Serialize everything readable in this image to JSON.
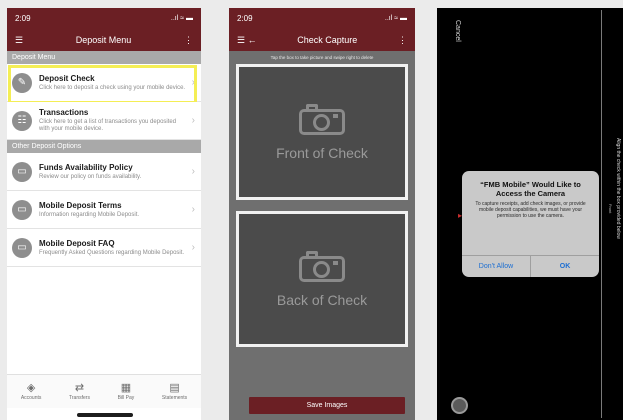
{
  "screen1": {
    "status": {
      "time": "2:09",
      "signal": "..ıl ≈ ▬"
    },
    "nav": {
      "title": "Deposit Menu"
    },
    "section1": "Deposit Menu",
    "items1": [
      {
        "title": "Deposit Check",
        "desc": "Click here to deposit a check using your mobile device."
      },
      {
        "title": "Transactions",
        "desc": "Click here to get a list of transactions you deposited with your mobile device."
      }
    ],
    "section2": "Other Deposit Options",
    "items2": [
      {
        "title": "Funds Availability Policy",
        "desc": "Review our policy on funds availability."
      },
      {
        "title": "Mobile Deposit Terms",
        "desc": "Information regarding Mobile Deposit."
      },
      {
        "title": "Mobile Deposit FAQ",
        "desc": "Frequently Asked Questions regarding Mobile Deposit."
      }
    ],
    "tabs": [
      "Accounts",
      "Transfers",
      "Bill Pay",
      "Statements"
    ]
  },
  "screen2": {
    "status": {
      "time": "2:09",
      "signal": "..ıl ≈ ▬"
    },
    "nav": {
      "title": "Check Capture"
    },
    "instructions": "Tap the box to take picture and swipe right to delete",
    "front_label": "Front of Check",
    "back_label": "Back of Check",
    "save_label": "Save Images"
  },
  "screen3": {
    "cancel": "Cancel",
    "side_text": "Align the check within the box provided below",
    "side_sub": "Front",
    "dialog": {
      "title": "“FMB Mobile” Would Like to Access the Camera",
      "message": "To capture receipts, add check images, or provide mobile deposit capabilities, we must have your permission to use the camera.",
      "deny": "Don't Allow",
      "ok": "OK"
    }
  },
  "colors": {
    "brand": "#6b1f24",
    "highlight": "#f4ee55",
    "ios_blue": "#1c6ed2"
  }
}
